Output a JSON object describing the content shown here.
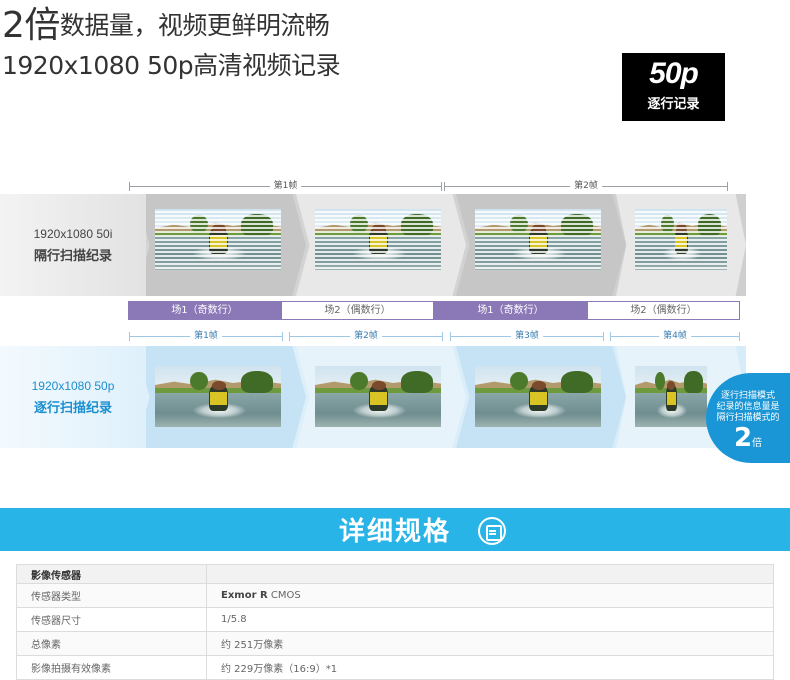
{
  "headline": {
    "line1_big": "2倍",
    "line1_rest": "数据量，视频更鲜明流畅",
    "line2": "1920x1080 50p高清视频记录"
  },
  "badge": {
    "big": "50p",
    "small": "逐行记录"
  },
  "interlaced": {
    "frame_labels": [
      "第1帧",
      "第2帧"
    ],
    "label_line1": "1920x1080  50i",
    "label_line2": "隔行扫描纪录",
    "fields": [
      "场1（奇数行）",
      "场2（偶数行）",
      "场1（奇数行）",
      "场2（偶数行）"
    ]
  },
  "progressive": {
    "frame_labels": [
      "第1帧",
      "第2帧",
      "第3帧",
      "第4帧"
    ],
    "label_line1": "1920x1080  50p",
    "label_line2": "逐行扫描纪录"
  },
  "callout": {
    "line1": "逐行扫描模式",
    "line2": "纪录的信息量是",
    "line3": "隔行扫描模式的",
    "number": "2",
    "unit": "倍"
  },
  "specs": {
    "title": "详细规格",
    "icon": "document-icon",
    "section": "影像传感器",
    "rows": [
      {
        "key": "传感器类型",
        "brand": "Exmor R",
        "value": " CMOS"
      },
      {
        "key": "传感器尺寸",
        "brand": "",
        "value": "1/5.8"
      },
      {
        "key": "总像素",
        "brand": "",
        "value": "约 251万像素"
      },
      {
        "key": "影像拍摄有效像素",
        "brand": "",
        "value": "约 229万像素（16:9）*1"
      }
    ]
  },
  "colors": {
    "accent_blue": "#1a96d6",
    "spec_bar": "#28b4e6",
    "field_purple": "#8b78b6"
  }
}
